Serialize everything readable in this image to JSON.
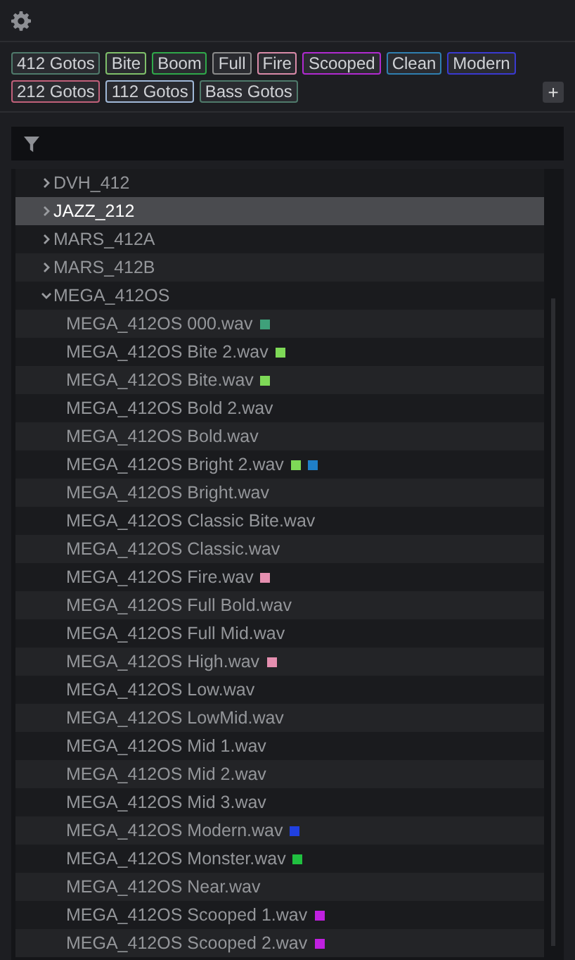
{
  "tags": [
    {
      "label": "412 Gotos",
      "color": "#4f7a6b"
    },
    {
      "label": "Bite",
      "color": "#7fbf6a"
    },
    {
      "label": "Boom",
      "color": "#2fa84a"
    },
    {
      "label": "Full",
      "color": "#8a8a8a"
    },
    {
      "label": "Fire",
      "color": "#d98aa8"
    },
    {
      "label": "Scooped",
      "color": "#b02ad0"
    },
    {
      "label": "Clean",
      "color": "#2f7fb0"
    },
    {
      "label": "Modern",
      "color": "#3a3ad0"
    },
    {
      "label": "212 Gotos",
      "color": "#c0607a"
    },
    {
      "label": "112 Gotos",
      "color": "#a0b8d8"
    },
    {
      "label": "Bass Gotos",
      "color": "#4f7a6b"
    }
  ],
  "add_button": "+",
  "tree": [
    {
      "label": "DVH_412",
      "expanded": false,
      "selected": false
    },
    {
      "label": "JAZZ_212",
      "expanded": false,
      "selected": true
    },
    {
      "label": "MARS_412A",
      "expanded": false,
      "selected": false
    },
    {
      "label": "MARS_412B",
      "expanded": false,
      "selected": false
    },
    {
      "label": "MEGA_412OS",
      "expanded": true,
      "selected": false,
      "children": [
        {
          "label": "MEGA_412OS 000.wav",
          "selected": false,
          "tags": [
            {
              "color": "#3fa07a"
            }
          ]
        },
        {
          "label": "MEGA_412OS Bite 2.wav",
          "selected": false,
          "tags": [
            {
              "color": "#7ed957"
            }
          ]
        },
        {
          "label": "MEGA_412OS Bite.wav",
          "selected": false,
          "tags": [
            {
              "color": "#7ed957"
            }
          ]
        },
        {
          "label": "MEGA_412OS Bold 2.wav",
          "selected": false
        },
        {
          "label": "MEGA_412OS Bold.wav",
          "selected": false
        },
        {
          "label": "MEGA_412OS Bright 2.wav",
          "selected": false,
          "tags": [
            {
              "color": "#7ed957"
            },
            {
              "color": "#1f7fc8"
            }
          ]
        },
        {
          "label": "MEGA_412OS Bright.wav",
          "selected": false
        },
        {
          "label": "MEGA_412OS Classic Bite.wav",
          "selected": false
        },
        {
          "label": "MEGA_412OS Classic.wav",
          "selected": false
        },
        {
          "label": "MEGA_412OS Fire.wav",
          "selected": false,
          "tags": [
            {
              "color": "#e58fb0"
            }
          ]
        },
        {
          "label": "MEGA_412OS Full Bold.wav",
          "selected": false
        },
        {
          "label": "MEGA_412OS Full Mid.wav",
          "selected": false
        },
        {
          "label": "MEGA_412OS High.wav",
          "selected": false,
          "tags": [
            {
              "color": "#e58fb0"
            }
          ]
        },
        {
          "label": "MEGA_412OS Low.wav",
          "selected": false
        },
        {
          "label": "MEGA_412OS LowMid.wav",
          "selected": false
        },
        {
          "label": "MEGA_412OS Mid 1.wav",
          "selected": false
        },
        {
          "label": "MEGA_412OS Mid 2.wav",
          "selected": false
        },
        {
          "label": "MEGA_412OS Mid 3.wav",
          "selected": false
        },
        {
          "label": "MEGA_412OS Modern.wav",
          "selected": false,
          "tags": [
            {
              "color": "#2040e0"
            }
          ]
        },
        {
          "label": "MEGA_412OS Monster.wav",
          "selected": false,
          "tags": [
            {
              "color": "#20c040"
            }
          ]
        },
        {
          "label": "MEGA_412OS Near.wav",
          "selected": false
        },
        {
          "label": "MEGA_412OS Scooped 1.wav",
          "selected": false,
          "tags": [
            {
              "color": "#c020e0"
            }
          ]
        },
        {
          "label": "MEGA_412OS Scooped 2.wav",
          "selected": false,
          "tags": [
            {
              "color": "#c020e0"
            }
          ]
        }
      ]
    }
  ]
}
